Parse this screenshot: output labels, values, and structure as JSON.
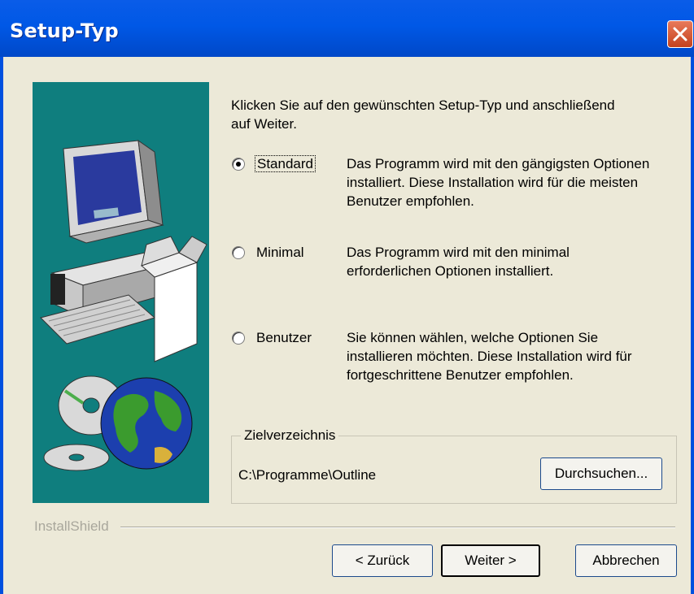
{
  "window": {
    "title": "Setup-Typ"
  },
  "intro_text_line1": "Klicken Sie auf den gewünschten Setup-Typ und anschließend",
  "intro_text_line2": "auf Weiter.",
  "options": [
    {
      "label": "Standard",
      "selected": true,
      "description": [
        "Das Programm wird mit den gängigsten Optionen",
        "installiert. Diese Installation wird für die meisten",
        "Benutzer empfohlen."
      ]
    },
    {
      "label": "Minimal",
      "selected": false,
      "description": [
        "Das Programm wird mit den minimal",
        "erforderlichen Optionen installiert."
      ]
    },
    {
      "label": "Benutzer",
      "selected": false,
      "description": [
        "Sie können wählen, welche Optionen Sie",
        "installieren möchten. Diese Installation wird für",
        "fortgeschrittene Benutzer empfohlen."
      ]
    }
  ],
  "destination": {
    "legend": "Zielverzeichnis",
    "path": "C:\\Programme\\Outline",
    "browse_label": "Durchsuchen..."
  },
  "brand": "InstallShield",
  "buttons": {
    "back": "< Zurück",
    "next": "Weiter >",
    "cancel": "Abbrechen"
  },
  "colors": {
    "titlebar": "#0058e6",
    "art_background": "#0f7e7e",
    "dialog_background": "#ece9d8"
  },
  "icons": {
    "close": "close-icon",
    "artwork": "computer-illustration"
  }
}
